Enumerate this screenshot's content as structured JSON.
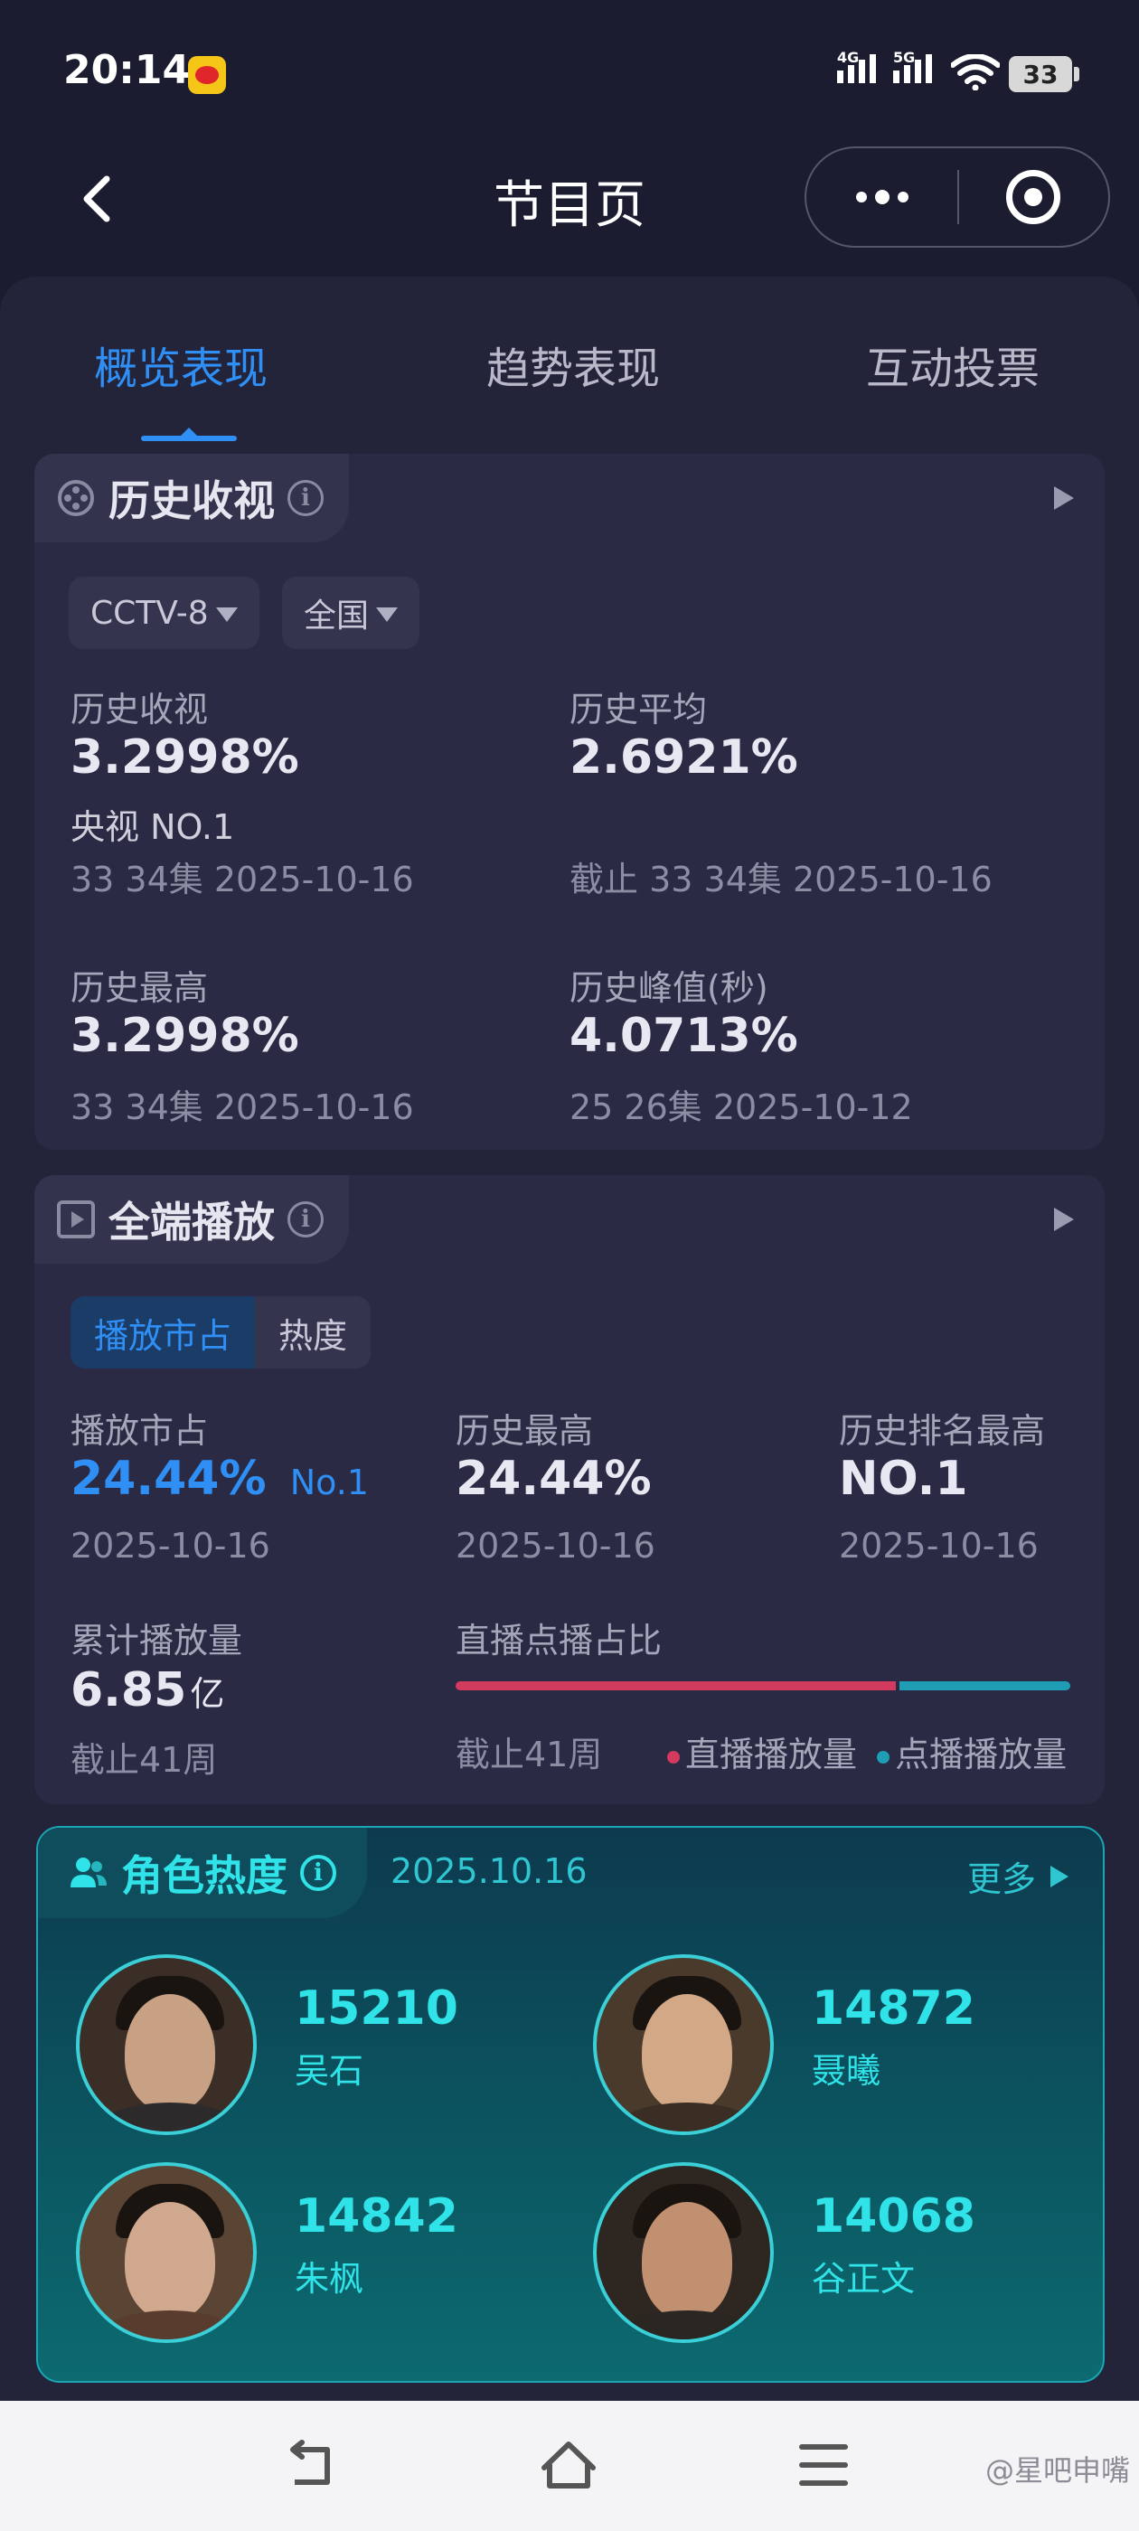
{
  "status_bar": {
    "time": "20:14",
    "network_1": "4G",
    "network_2": "5G",
    "battery": "33"
  },
  "nav": {
    "title": "节目页"
  },
  "tabs": [
    {
      "label": "概览表现",
      "active": true
    },
    {
      "label": "趋势表现",
      "active": false
    },
    {
      "label": "互动投票",
      "active": false
    }
  ],
  "history_ratings": {
    "title": "历史收视",
    "channel_filter": "CCTV-8",
    "region_filter": "全国",
    "hist_rating_label": "历史收视",
    "hist_rating_value": "3.2998%",
    "hist_rating_rank": "央视 NO.1",
    "hist_rating_note": "33 34集 2025-10-16",
    "avg_label": "历史平均",
    "avg_value": "2.6921%",
    "avg_note": "截止 33 34集 2025-10-16",
    "max_label": "历史最高",
    "max_value": "3.2998%",
    "max_note": "33 34集 2025-10-16",
    "peak_label": "历史峰值(秒)",
    "peak_value": "4.0713%",
    "peak_note": "25 26集 2025-10-12"
  },
  "all_platform": {
    "title": "全端播放",
    "seg_share": "播放市占",
    "seg_heat": "热度",
    "share_label": "播放市占",
    "share_value": "24.44%",
    "share_rank": "No.1",
    "share_date": "2025-10-16",
    "max_label": "历史最高",
    "max_value": "24.44%",
    "max_date": "2025-10-16",
    "rank_label": "历史排名最高",
    "rank_value": "NO.1",
    "rank_date": "2025-10-16",
    "cumulative_label": "累计播放量",
    "cumulative_value": "6.85",
    "cumulative_unit": "亿",
    "cumulative_note": "截止41周",
    "ratio_label": "直播点播占比",
    "ratio_note": "截止41周",
    "legend_live": "直播播放量",
    "legend_vod": "点播播放量",
    "live_fraction": 0.72,
    "color_live": "#d23a5e",
    "color_vod": "#1e9db4"
  },
  "role_heat": {
    "title": "角色热度",
    "date": "2025.10.16",
    "more": "更多",
    "roles": [
      {
        "heat": "15210",
        "name": "吴石"
      },
      {
        "heat": "14872",
        "name": "聂曦"
      },
      {
        "heat": "14842",
        "name": "朱枫"
      },
      {
        "heat": "14068",
        "name": "谷正文"
      }
    ]
  },
  "watermark": "@星吧申嘴"
}
